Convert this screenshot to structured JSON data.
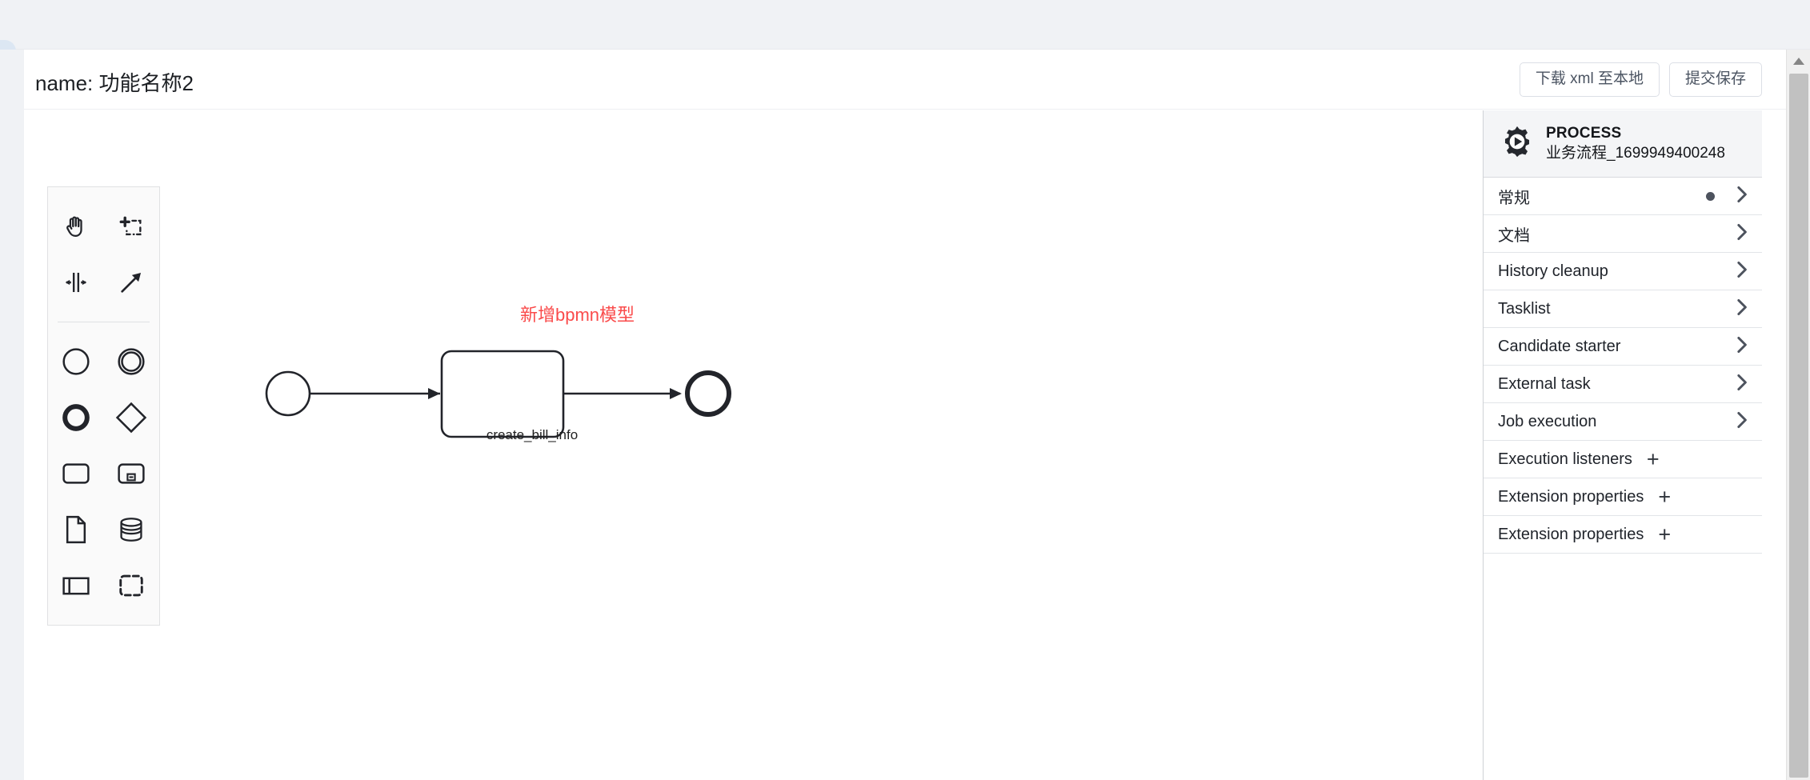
{
  "header": {
    "title": "name: 功能名称2",
    "buttons": [
      {
        "label": "下载 xml 至本地",
        "name": "download-xml-button"
      },
      {
        "label": "提交保存",
        "name": "submit-save-button"
      }
    ]
  },
  "palette": {
    "tools": [
      {
        "name": "hand-tool-icon",
        "title": "activate the hand tool"
      },
      {
        "name": "lasso-tool-icon",
        "title": "activate the lasso tool"
      },
      {
        "name": "space-tool-icon",
        "title": "activate the create/remove space tool"
      },
      {
        "name": "global-connect-tool-icon",
        "title": "activate the global connect tool"
      }
    ],
    "elements": [
      {
        "name": "start-event-icon",
        "title": "create StartEvent"
      },
      {
        "name": "intermediate-event-icon",
        "title": "create Intermediate/Boundary Event"
      },
      {
        "name": "end-event-icon",
        "title": "create EndEvent"
      },
      {
        "name": "gateway-icon",
        "title": "create Gateway"
      },
      {
        "name": "task-icon",
        "title": "create Task"
      },
      {
        "name": "subprocess-icon",
        "title": "create expanded SubProcess"
      },
      {
        "name": "data-object-icon",
        "title": "create DataObjectReference"
      },
      {
        "name": "data-store-icon",
        "title": "create DataStoreReference"
      },
      {
        "name": "participant-icon",
        "title": "create Pool/Participant"
      },
      {
        "name": "group-icon",
        "title": "create Group"
      }
    ]
  },
  "canvas": {
    "annotation": "新增bpmn模型",
    "task_label": "create_bill_info",
    "elements": [
      {
        "type": "start-event",
        "name": "start-event"
      },
      {
        "type": "task",
        "name": "task-create-bill-info"
      },
      {
        "type": "end-event",
        "name": "end-event"
      }
    ]
  },
  "properties": {
    "kind": "PROCESS",
    "name": "业务流程_1699949400248",
    "icon": "process-gear-play-icon",
    "rows": [
      {
        "label": "常规",
        "name": "prop-group-general",
        "dot": true,
        "action": "chevron"
      },
      {
        "label": "文档",
        "name": "prop-group-documentation",
        "dot": false,
        "action": "chevron"
      },
      {
        "label": "History cleanup",
        "name": "prop-group-history-cleanup",
        "dot": false,
        "action": "chevron"
      },
      {
        "label": "Tasklist",
        "name": "prop-group-tasklist",
        "dot": false,
        "action": "chevron"
      },
      {
        "label": "Candidate starter",
        "name": "prop-group-candidate-starter",
        "dot": false,
        "action": "chevron"
      },
      {
        "label": "External task",
        "name": "prop-group-external-task",
        "dot": false,
        "action": "chevron"
      },
      {
        "label": "Job execution",
        "name": "prop-group-job-execution",
        "dot": false,
        "action": "chevron"
      },
      {
        "label": "Execution listeners",
        "name": "prop-group-execution-listeners",
        "dot": false,
        "action": "plus"
      },
      {
        "label": "Extension properties",
        "name": "prop-group-extension-properties-1",
        "dot": false,
        "action": "plus"
      },
      {
        "label": "Extension properties",
        "name": "prop-group-extension-properties-2",
        "dot": false,
        "action": "plus"
      }
    ],
    "plus_label": "+"
  },
  "colors": {
    "accent_red": "#fa4b4b",
    "background": "#f0f2f5",
    "panel_header": "#f4f5f7",
    "stroke": "#22242a"
  }
}
